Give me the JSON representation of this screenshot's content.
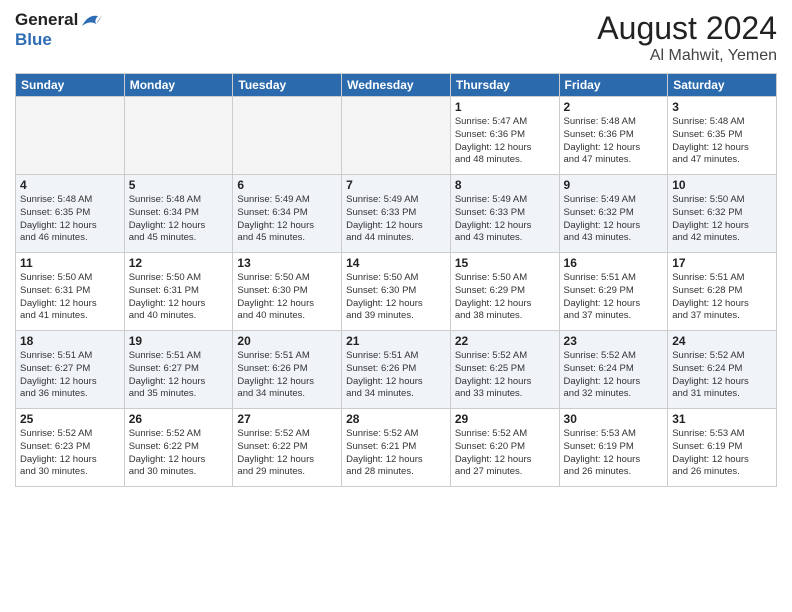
{
  "header": {
    "logo_general": "General",
    "logo_blue": "Blue",
    "month_year": "August 2024",
    "location": "Al Mahwit, Yemen"
  },
  "weekdays": [
    "Sunday",
    "Monday",
    "Tuesday",
    "Wednesday",
    "Thursday",
    "Friday",
    "Saturday"
  ],
  "weeks": [
    [
      {
        "day": "",
        "info": ""
      },
      {
        "day": "",
        "info": ""
      },
      {
        "day": "",
        "info": ""
      },
      {
        "day": "",
        "info": ""
      },
      {
        "day": "1",
        "info": "Sunrise: 5:47 AM\nSunset: 6:36 PM\nDaylight: 12 hours\nand 48 minutes."
      },
      {
        "day": "2",
        "info": "Sunrise: 5:48 AM\nSunset: 6:36 PM\nDaylight: 12 hours\nand 47 minutes."
      },
      {
        "day": "3",
        "info": "Sunrise: 5:48 AM\nSunset: 6:35 PM\nDaylight: 12 hours\nand 47 minutes."
      }
    ],
    [
      {
        "day": "4",
        "info": "Sunrise: 5:48 AM\nSunset: 6:35 PM\nDaylight: 12 hours\nand 46 minutes."
      },
      {
        "day": "5",
        "info": "Sunrise: 5:48 AM\nSunset: 6:34 PM\nDaylight: 12 hours\nand 45 minutes."
      },
      {
        "day": "6",
        "info": "Sunrise: 5:49 AM\nSunset: 6:34 PM\nDaylight: 12 hours\nand 45 minutes."
      },
      {
        "day": "7",
        "info": "Sunrise: 5:49 AM\nSunset: 6:33 PM\nDaylight: 12 hours\nand 44 minutes."
      },
      {
        "day": "8",
        "info": "Sunrise: 5:49 AM\nSunset: 6:33 PM\nDaylight: 12 hours\nand 43 minutes."
      },
      {
        "day": "9",
        "info": "Sunrise: 5:49 AM\nSunset: 6:32 PM\nDaylight: 12 hours\nand 43 minutes."
      },
      {
        "day": "10",
        "info": "Sunrise: 5:50 AM\nSunset: 6:32 PM\nDaylight: 12 hours\nand 42 minutes."
      }
    ],
    [
      {
        "day": "11",
        "info": "Sunrise: 5:50 AM\nSunset: 6:31 PM\nDaylight: 12 hours\nand 41 minutes."
      },
      {
        "day": "12",
        "info": "Sunrise: 5:50 AM\nSunset: 6:31 PM\nDaylight: 12 hours\nand 40 minutes."
      },
      {
        "day": "13",
        "info": "Sunrise: 5:50 AM\nSunset: 6:30 PM\nDaylight: 12 hours\nand 40 minutes."
      },
      {
        "day": "14",
        "info": "Sunrise: 5:50 AM\nSunset: 6:30 PM\nDaylight: 12 hours\nand 39 minutes."
      },
      {
        "day": "15",
        "info": "Sunrise: 5:50 AM\nSunset: 6:29 PM\nDaylight: 12 hours\nand 38 minutes."
      },
      {
        "day": "16",
        "info": "Sunrise: 5:51 AM\nSunset: 6:29 PM\nDaylight: 12 hours\nand 37 minutes."
      },
      {
        "day": "17",
        "info": "Sunrise: 5:51 AM\nSunset: 6:28 PM\nDaylight: 12 hours\nand 37 minutes."
      }
    ],
    [
      {
        "day": "18",
        "info": "Sunrise: 5:51 AM\nSunset: 6:27 PM\nDaylight: 12 hours\nand 36 minutes."
      },
      {
        "day": "19",
        "info": "Sunrise: 5:51 AM\nSunset: 6:27 PM\nDaylight: 12 hours\nand 35 minutes."
      },
      {
        "day": "20",
        "info": "Sunrise: 5:51 AM\nSunset: 6:26 PM\nDaylight: 12 hours\nand 34 minutes."
      },
      {
        "day": "21",
        "info": "Sunrise: 5:51 AM\nSunset: 6:26 PM\nDaylight: 12 hours\nand 34 minutes."
      },
      {
        "day": "22",
        "info": "Sunrise: 5:52 AM\nSunset: 6:25 PM\nDaylight: 12 hours\nand 33 minutes."
      },
      {
        "day": "23",
        "info": "Sunrise: 5:52 AM\nSunset: 6:24 PM\nDaylight: 12 hours\nand 32 minutes."
      },
      {
        "day": "24",
        "info": "Sunrise: 5:52 AM\nSunset: 6:24 PM\nDaylight: 12 hours\nand 31 minutes."
      }
    ],
    [
      {
        "day": "25",
        "info": "Sunrise: 5:52 AM\nSunset: 6:23 PM\nDaylight: 12 hours\nand 30 minutes."
      },
      {
        "day": "26",
        "info": "Sunrise: 5:52 AM\nSunset: 6:22 PM\nDaylight: 12 hours\nand 30 minutes."
      },
      {
        "day": "27",
        "info": "Sunrise: 5:52 AM\nSunset: 6:22 PM\nDaylight: 12 hours\nand 29 minutes."
      },
      {
        "day": "28",
        "info": "Sunrise: 5:52 AM\nSunset: 6:21 PM\nDaylight: 12 hours\nand 28 minutes."
      },
      {
        "day": "29",
        "info": "Sunrise: 5:52 AM\nSunset: 6:20 PM\nDaylight: 12 hours\nand 27 minutes."
      },
      {
        "day": "30",
        "info": "Sunrise: 5:53 AM\nSunset: 6:19 PM\nDaylight: 12 hours\nand 26 minutes."
      },
      {
        "day": "31",
        "info": "Sunrise: 5:53 AM\nSunset: 6:19 PM\nDaylight: 12 hours\nand 26 minutes."
      }
    ]
  ]
}
